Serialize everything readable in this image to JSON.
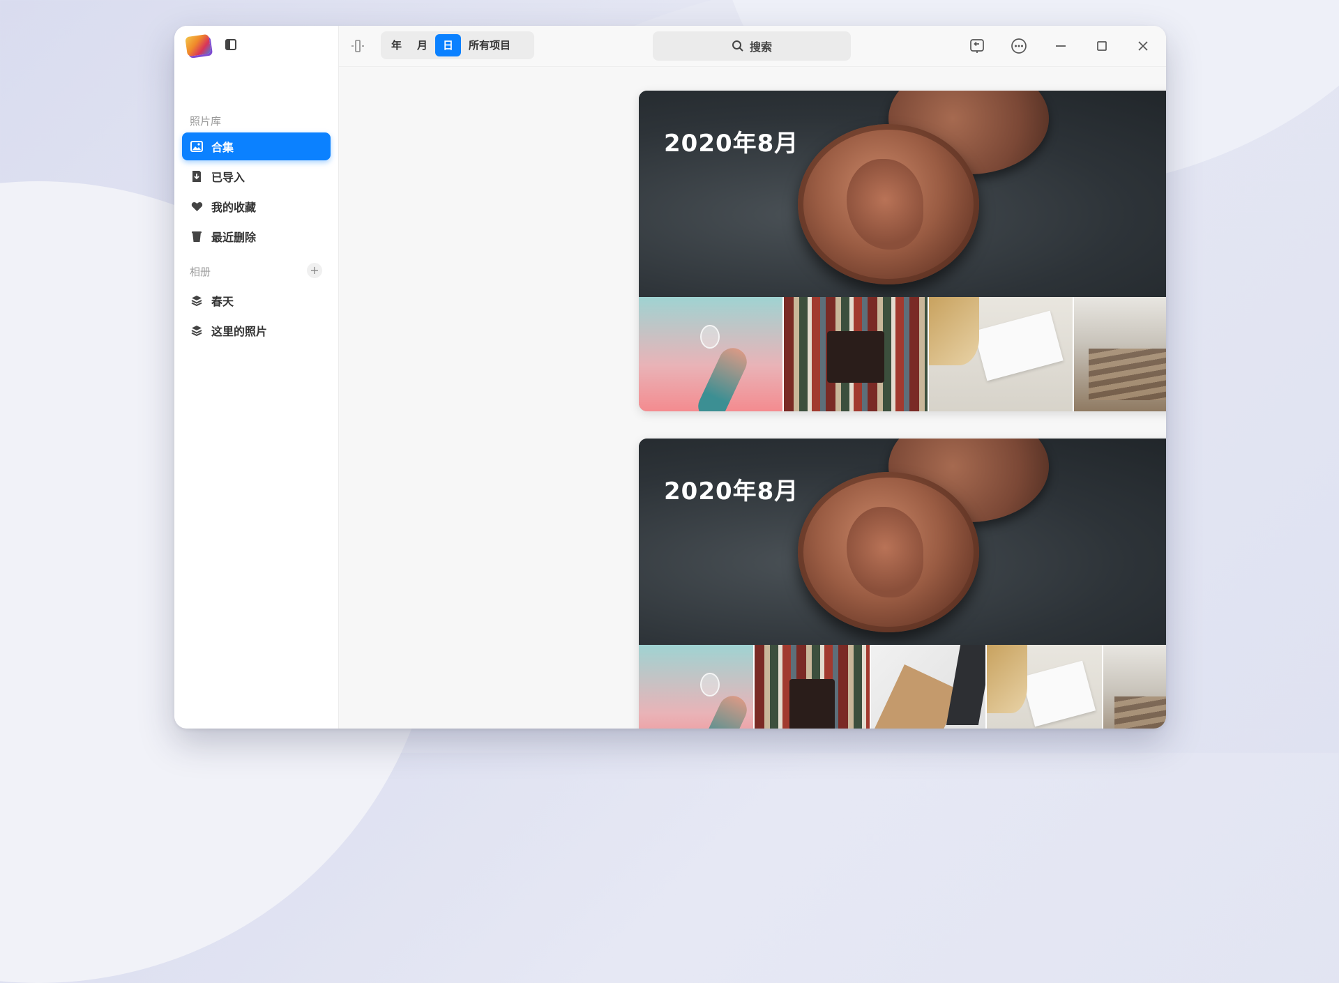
{
  "window": {
    "sidebar": {
      "library_label": "照片库",
      "library_items": [
        {
          "label": "合集",
          "icon": "image-icon",
          "active": true
        },
        {
          "label": "已导入",
          "icon": "import-icon",
          "active": false
        },
        {
          "label": "我的收藏",
          "icon": "heart-icon",
          "active": false
        },
        {
          "label": "最近删除",
          "icon": "trash-icon",
          "active": false
        }
      ],
      "albums_label": "相册",
      "add_album_icon": "+",
      "album_items": [
        {
          "label": "春天",
          "icon": "album-stack-icon"
        },
        {
          "label": "这里的照片",
          "icon": "album-stack-icon"
        }
      ]
    },
    "toolbar": {
      "view_tabs": [
        {
          "label": "年",
          "active": false
        },
        {
          "label": "月",
          "active": false
        },
        {
          "label": "日",
          "active": true
        },
        {
          "label": "所有项目",
          "active": false
        }
      ],
      "search_label": "搜索"
    },
    "main": {
      "day_groups": [
        {
          "title": "2020年8月",
          "thumbnail_count": 4
        },
        {
          "title": "2020年8月",
          "thumbnail_count": 5
        }
      ]
    },
    "colors": {
      "accent": "#0b81ff"
    }
  }
}
